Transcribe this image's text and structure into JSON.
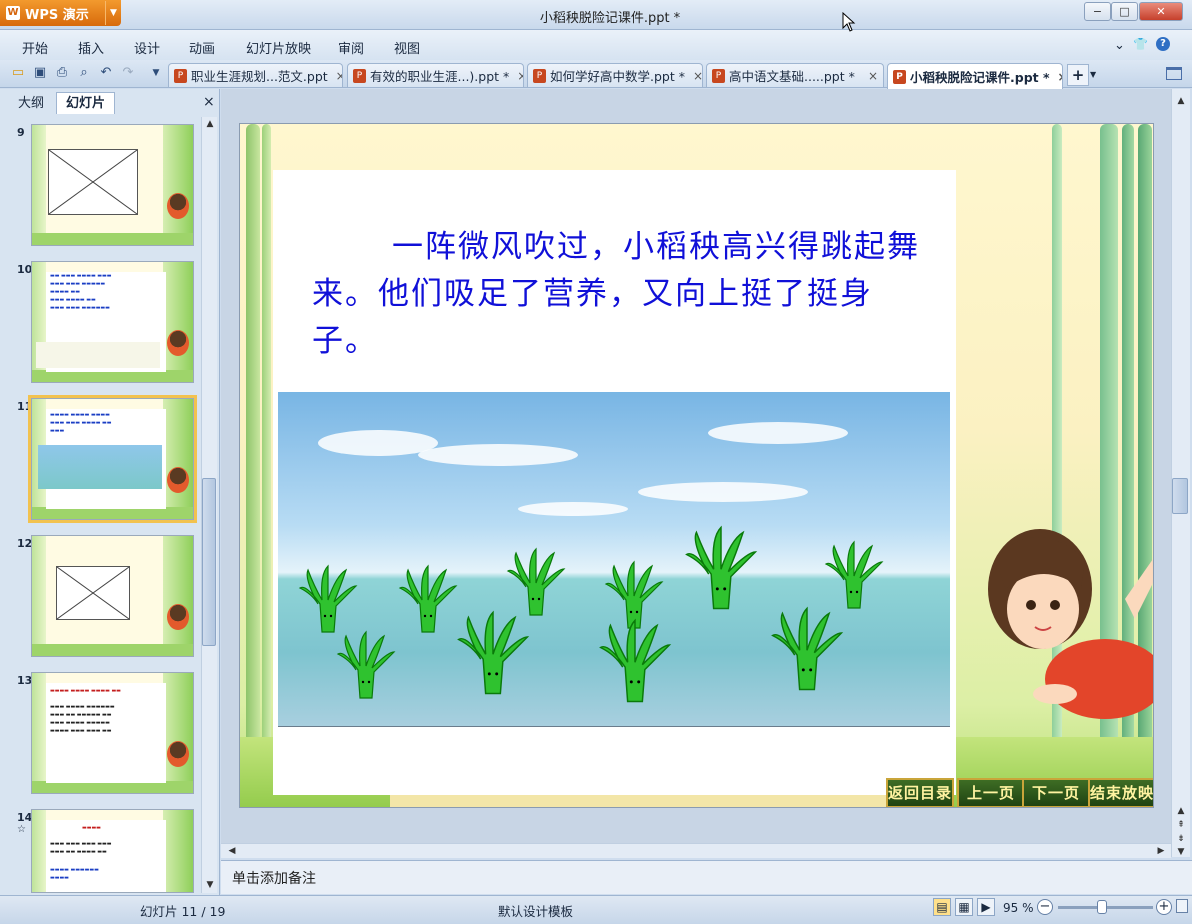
{
  "app": {
    "name": "WPS 演示",
    "window_title": "小稻秧脱险记课件.ppt *"
  },
  "window_controls": {
    "minimize": "−",
    "maximize": "□",
    "close": "✕"
  },
  "menu": [
    "开始",
    "插入",
    "设计",
    "动画",
    "幻灯片放映",
    "审阅",
    "视图"
  ],
  "menu_right": {
    "collapse": "⌄",
    "skin": "👕",
    "help": "?"
  },
  "toolbar": [
    "open-icon",
    "save-icon",
    "print-icon",
    "print-preview-icon",
    "undo-icon",
    "redo-icon",
    "customize-icon"
  ],
  "tabs": [
    {
      "label": "职业生涯规划...范文.ppt",
      "close": "×"
    },
    {
      "label": "有效的职业生涯...).ppt *",
      "close": "×"
    },
    {
      "label": "如何学好高中数学.ppt *",
      "close": "×"
    },
    {
      "label": "高中语文基础.....ppt *",
      "close": "×"
    },
    {
      "label": "小稻秧脱险记课件.ppt *",
      "close": "×",
      "active": true
    }
  ],
  "new_tab": "+",
  "left_panel": {
    "tabs": [
      "大纲",
      "幻灯片"
    ],
    "active_tab": "幻灯片",
    "close": "×",
    "thumbnails": [
      {
        "number": "9",
        "type": "placeholder"
      },
      {
        "number": "10",
        "type": "text-scene"
      },
      {
        "number": "11",
        "type": "text-scene",
        "selected": true
      },
      {
        "number": "12",
        "type": "placeholder"
      },
      {
        "number": "13",
        "type": "text"
      },
      {
        "number": "14",
        "marker": "☆",
        "type": "text"
      }
    ]
  },
  "slide": {
    "text": "一阵微风吹过，小稻秧高兴得跳起舞来。他们吸足了营养，又向上挺了挺身子。",
    "buttons": [
      "返回目录",
      "上一页",
      "下一页",
      "结束放映"
    ]
  },
  "notes_placeholder": "单击添加备注",
  "status": {
    "slide_count": "幻灯片 11 / 19",
    "template": "默认设计模板",
    "zoom": "95 %",
    "zoom_percent": 95
  },
  "colors": {
    "accent": "#f39a2e",
    "slide_text": "#1010d8",
    "nav_button": "#2e5a1a"
  }
}
